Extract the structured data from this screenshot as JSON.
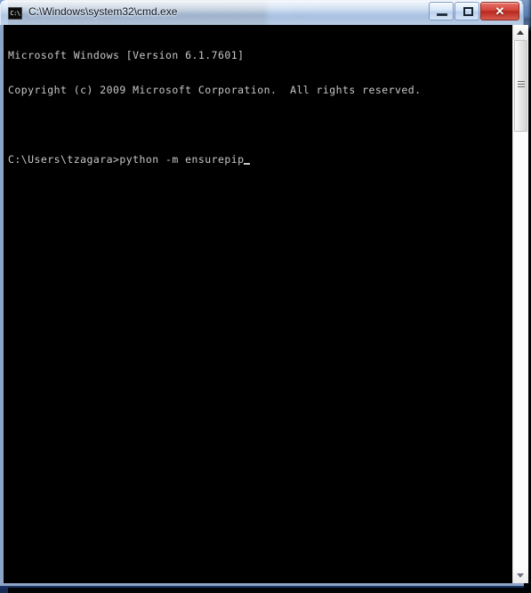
{
  "window": {
    "title": "C:\\Windows\\system32\\cmd.exe",
    "icon_name": "cmd-exe-icon",
    "icon_text": "C:\\",
    "controls": {
      "minimize_label": "",
      "maximize_label": "",
      "close_label": "✕"
    }
  },
  "console": {
    "lines": [
      "Microsoft Windows [Version 6.1.7601]",
      "Copyright (c) 2009 Microsoft Corporation.  All rights reserved.",
      "",
      "C:\\Users\\tzagara>python -m ensurepip"
    ],
    "prompt": "C:\\Users\\tzagara>",
    "command": "python -m ensurepip",
    "foreground_color": "#c8c8c8",
    "background_color": "#000000"
  },
  "scrollbar": {
    "up_arrow_label": "▲",
    "down_arrow_label": "▼",
    "thumb_position_percent": 0,
    "thumb_size_percent": 17
  },
  "desktop": {
    "accent_color": "#2f4d84",
    "background_window_present": true
  }
}
